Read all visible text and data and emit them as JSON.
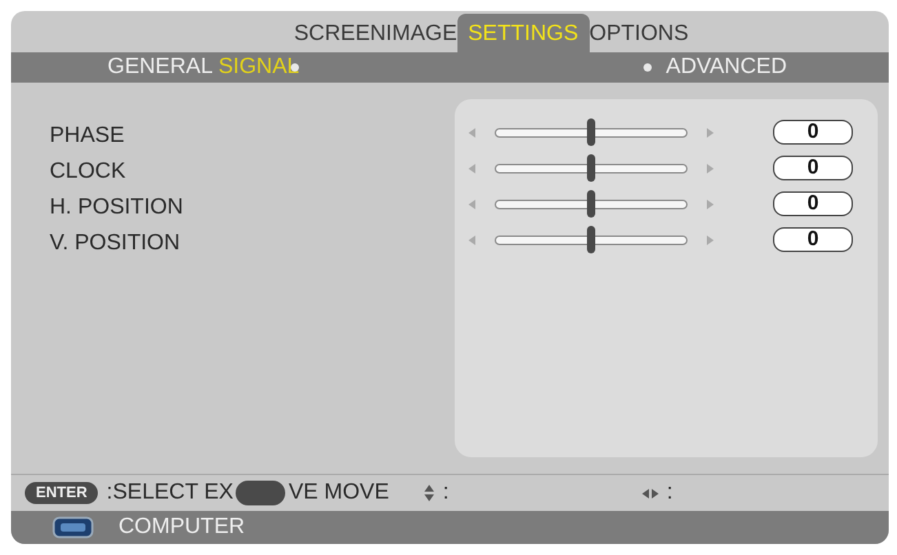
{
  "tabs": [
    {
      "label": "SCREEN",
      "selected": false
    },
    {
      "label": "IMAGE",
      "selected": false
    },
    {
      "label": "SETTINGS",
      "selected": true
    },
    {
      "label": "OPTIONS",
      "selected": false
    }
  ],
  "subtabs": [
    {
      "label": "GENERAL",
      "selected": false
    },
    {
      "label": "SIGNAL",
      "selected": true
    },
    {
      "label": "ADVANCED",
      "selected": false
    }
  ],
  "settings": [
    {
      "label": "PHASE",
      "level": 0.5,
      "value": "0"
    },
    {
      "label": "CLOCK",
      "level": 0.5,
      "value": "0"
    },
    {
      "label": "H. POSITION",
      "level": 0.5,
      "value": "0"
    },
    {
      "label": "V. POSITION",
      "level": 0.5,
      "value": "0"
    }
  ],
  "hints": {
    "enter_key": "ENTER",
    "select": ":SELECT EX",
    "move": "VE MOVE",
    "updown": ":",
    "leftright": ":"
  },
  "status_bar": {
    "source": "COMPUTER"
  }
}
